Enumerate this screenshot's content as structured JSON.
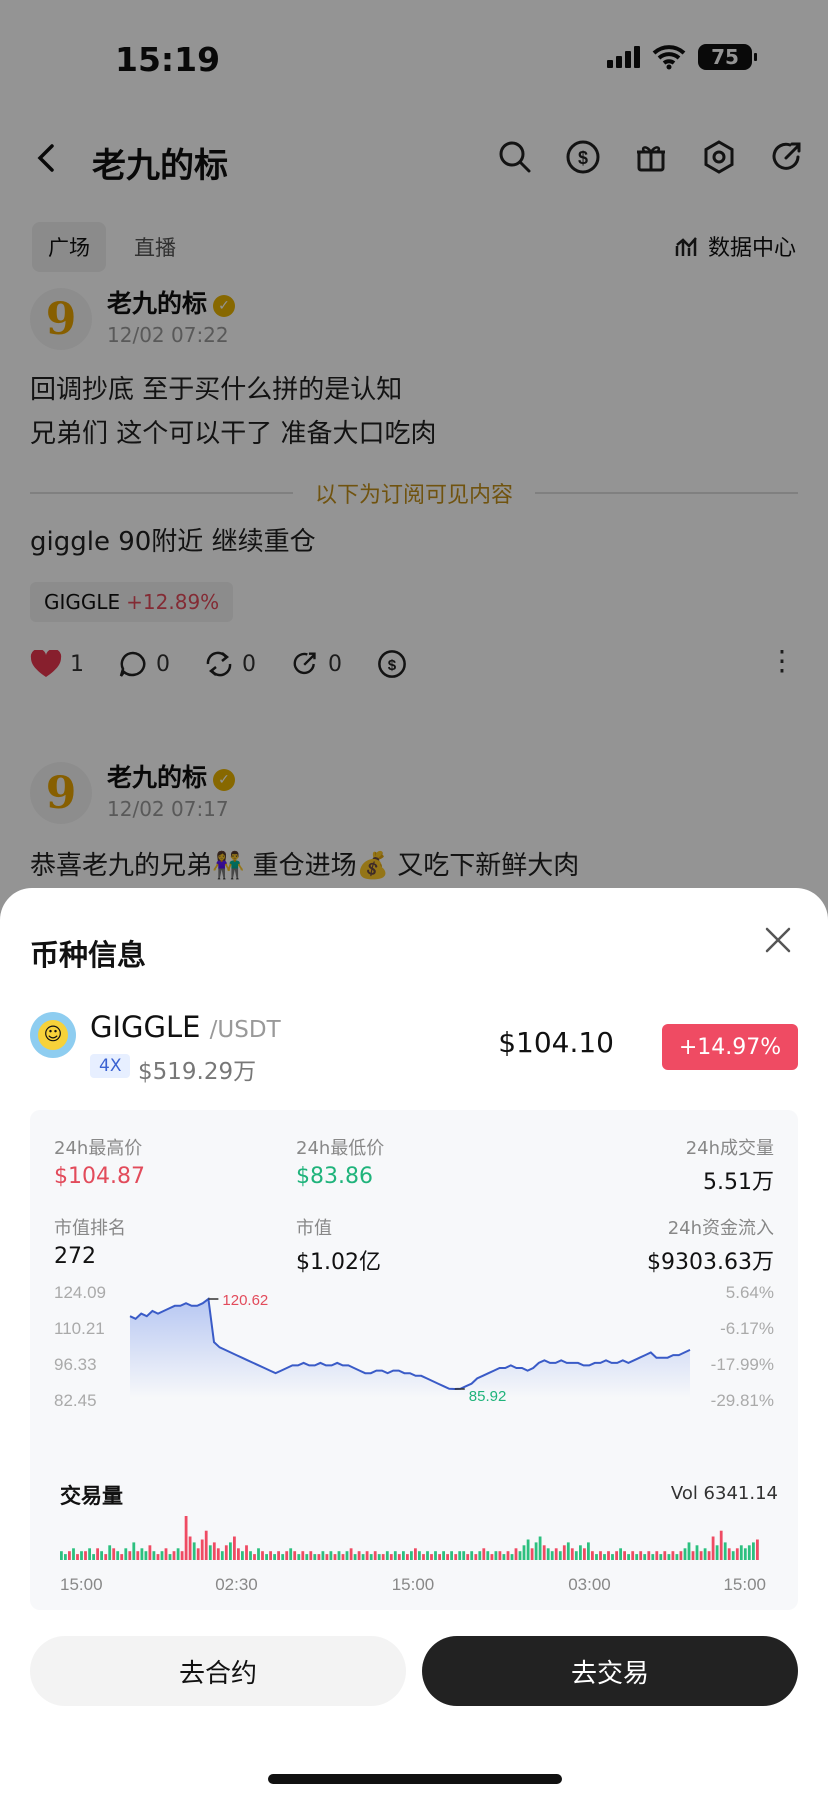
{
  "status": {
    "time": "15:19",
    "battery": "75"
  },
  "header": {
    "title": "老九的标",
    "back_icon": "chevron-left-icon"
  },
  "tabs": [
    "广场",
    "直播"
  ],
  "data_center": "数据中心",
  "posts": [
    {
      "author": "老九的标",
      "avatar": "9",
      "time": "12/02 07:22",
      "lines": [
        "回调抄底 至于买什么拼的是认知",
        "兄弟们 这个可以干了 准备大口吃肉"
      ],
      "subscribe_divider": "以下为订阅可见内容",
      "extra": "giggle 90附近 继续重仓",
      "tag": {
        "symbol": "GIGGLE",
        "pct": "+12.89%"
      },
      "likes": "1",
      "comments": "0",
      "reposts": "0",
      "shares": "0"
    },
    {
      "author": "老九的标",
      "avatar": "9",
      "time": "12/02 07:17",
      "line": "恭喜老九的兄弟👫 重仓进场💰 又吃下新鲜大肉"
    }
  ],
  "sheet": {
    "title": "币种信息",
    "coin": {
      "name": "GIGGLE",
      "pair": "/USDT",
      "leverage": "4X",
      "volume_line": "$519.29万",
      "price": "$104.10",
      "change": "+14.97%"
    },
    "stats": {
      "high_label": "24h最高价",
      "high": "$104.87",
      "low_label": "24h最低价",
      "low": "$83.86",
      "vol_label": "24h成交量",
      "vol": "5.51万",
      "rank_label": "市值排名",
      "rank": "272",
      "mcap_label": "市值",
      "mcap": "$1.02亿",
      "inflow_label": "24h资金流入",
      "inflow": "$9303.63万"
    },
    "chart": {
      "y_left": [
        "124.09",
        "110.21",
        "96.33",
        "82.45"
      ],
      "y_right": [
        "5.64%",
        "-6.17%",
        "-17.99%",
        "-29.81%"
      ],
      "max_label": "120.62",
      "min_label": "85.92",
      "accent": "#3a5bc7"
    },
    "volume": {
      "title": "交易量",
      "value": "Vol 6341.14",
      "x_ticks": [
        "15:00",
        "02:30",
        "15:00",
        "03:00",
        "15:00"
      ]
    },
    "buttons": {
      "contract": "去合约",
      "trade": "去交易"
    }
  },
  "chart_data": {
    "type": "line",
    "title": "",
    "xlabel": "",
    "ylabel": "",
    "ylim": [
      82.45,
      124.09
    ],
    "y2_ticks": [
      "5.64%",
      "-6.17%",
      "-17.99%",
      "-29.81%"
    ],
    "x_ticks": [
      "15:00",
      "02:30",
      "15:00",
      "03:00",
      "15:00"
    ],
    "series": [
      {
        "values": [
          114,
          113,
          115,
          114,
          116,
          115,
          116,
          117,
          118,
          118,
          119,
          118,
          118,
          119,
          120.62,
          104,
          102,
          101,
          100,
          99,
          98,
          97,
          96,
          95,
          94,
          93,
          92,
          93,
          94,
          95,
          95,
          96,
          95,
          95,
          96,
          95,
          95,
          96,
          95,
          95,
          94,
          93,
          92,
          92,
          93,
          93,
          92,
          93,
          93,
          92,
          92,
          91,
          91,
          90,
          89,
          88,
          87,
          86,
          85.92,
          86,
          87,
          88,
          90,
          91,
          92,
          93,
          94,
          94,
          95,
          94,
          94,
          93,
          94,
          96,
          97,
          96,
          96,
          97,
          96,
          96,
          96,
          95,
          95,
          96,
          96,
          97,
          96,
          96,
          97,
          96,
          97,
          98,
          99,
          100,
          98,
          98,
          98,
          99,
          99,
          100,
          101
        ]
      }
    ],
    "volume_series": {
      "title": "交易量",
      "values": [
        3,
        2,
        3,
        4,
        2,
        3,
        3,
        4,
        2,
        4,
        3,
        2,
        5,
        4,
        3,
        2,
        4,
        3,
        6,
        3,
        4,
        3,
        5,
        3,
        2,
        3,
        4,
        2,
        3,
        4,
        3,
        15,
        8,
        6,
        4,
        7,
        10,
        5,
        6,
        4,
        3,
        5,
        6,
        8,
        4,
        3,
        5,
        3,
        2,
        4,
        3,
        2,
        3,
        2,
        3,
        2,
        3,
        4,
        3,
        2,
        3,
        2,
        3,
        2,
        2,
        3,
        2,
        3,
        2,
        3,
        2,
        3,
        4,
        2,
        3,
        2,
        3,
        2,
        3,
        2,
        2,
        3,
        2,
        3,
        2,
        3,
        2,
        3,
        4,
        3,
        2,
        3,
        2,
        3,
        2,
        3,
        2,
        3,
        2,
        3,
        3,
        2,
        3,
        2,
        3,
        4,
        3,
        2,
        3,
        3,
        2,
        3,
        2,
        4,
        3,
        5,
        7,
        4,
        6,
        8,
        5,
        4,
        3,
        4,
        3,
        5,
        6,
        4,
        3,
        5,
        4,
        6,
        3,
        2,
        3,
        2,
        3,
        2,
        3,
        4,
        3,
        2,
        3,
        2,
        3,
        2,
        3,
        2,
        3,
        2,
        3,
        2,
        3,
        2,
        3,
        4,
        6,
        3,
        5,
        3,
        4,
        3,
        8,
        5,
        10,
        6,
        4,
        3,
        4,
        5,
        4,
        5,
        6,
        7
      ],
      "up": [
        1,
        1,
        0,
        1,
        0,
        1,
        0,
        1,
        1,
        0,
        1,
        0,
        1,
        0,
        1,
        0,
        1,
        0,
        1,
        0,
        1,
        1,
        0,
        1,
        0,
        1,
        0,
        1,
        0,
        1,
        0,
        0,
        0,
        1,
        0,
        0,
        0,
        1,
        0,
        0,
        1,
        0,
        1,
        0,
        0,
        1,
        0,
        1,
        0,
        1,
        0,
        1,
        0,
        1,
        0,
        1,
        0,
        1,
        0,
        1,
        0,
        1,
        0,
        1,
        0,
        1,
        0,
        1,
        0,
        1,
        0,
        1,
        0,
        1,
        0,
        1,
        0,
        1,
        0,
        1,
        0,
        1,
        0,
        1,
        0,
        1,
        0,
        1,
        0,
        1,
        0,
        1,
        0,
        1,
        0,
        1,
        0,
        1,
        0,
        1,
        1,
        0,
        1,
        0,
        1,
        0,
        1,
        0,
        1,
        0,
        1,
        0,
        1,
        0,
        1,
        1,
        1,
        0,
        1,
        1,
        0,
        1,
        1,
        0,
        1,
        0,
        1,
        0,
        1,
        1,
        0,
        1,
        0,
        1,
        0,
        1,
        0,
        1,
        0,
        1,
        0,
        1,
        0,
        1,
        0,
        1,
        0,
        1,
        0,
        1,
        0,
        1,
        0,
        1,
        0,
        1,
        1,
        0,
        1,
        0,
        1,
        0,
        0,
        1,
        0,
        1,
        0,
        1,
        0,
        1,
        1,
        1,
        1
      ]
    }
  }
}
